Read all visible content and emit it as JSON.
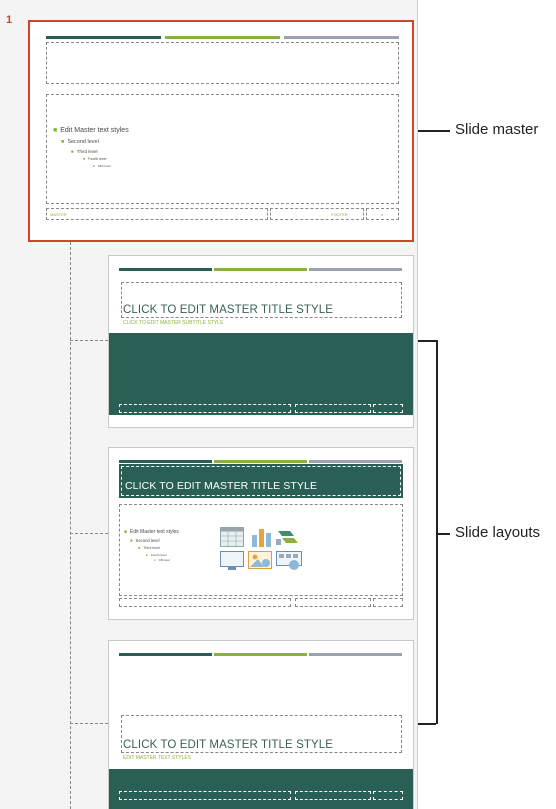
{
  "slide_number": "1",
  "master": {
    "level1": "Edit Master text styles",
    "level2": "Second level",
    "level3": "Third level",
    "level4": "Fourth level",
    "level5": "Fifth level",
    "footer_left": "MASTER",
    "footer_mid": "FOOTER",
    "footer_right": "#"
  },
  "layout1": {
    "title": "CLICK TO EDIT MASTER TITLE STYLE",
    "subtitle": "CLICK TO EDIT MASTER SUBTITLE STYLE"
  },
  "layout2": {
    "title": "CLICK TO EDIT MASTER TITLE STYLE",
    "level1": "Edit Master text styles",
    "level2": "Second level",
    "level3": "Third level",
    "level4": "Fourth level",
    "level5": "Fifth level"
  },
  "layout3": {
    "title": "CLICK TO EDIT MASTER TITLE STYLE",
    "subtitle": "EDIT MASTER TEXT STYLES"
  },
  "callouts": {
    "slide_master": "Slide master",
    "slide_layouts": "Slide layouts"
  },
  "colors": {
    "accent_dark": "#2a5f55",
    "accent_green": "#8ab33e",
    "accent_gray": "#9aa3ad",
    "selection": "#d2452a"
  }
}
